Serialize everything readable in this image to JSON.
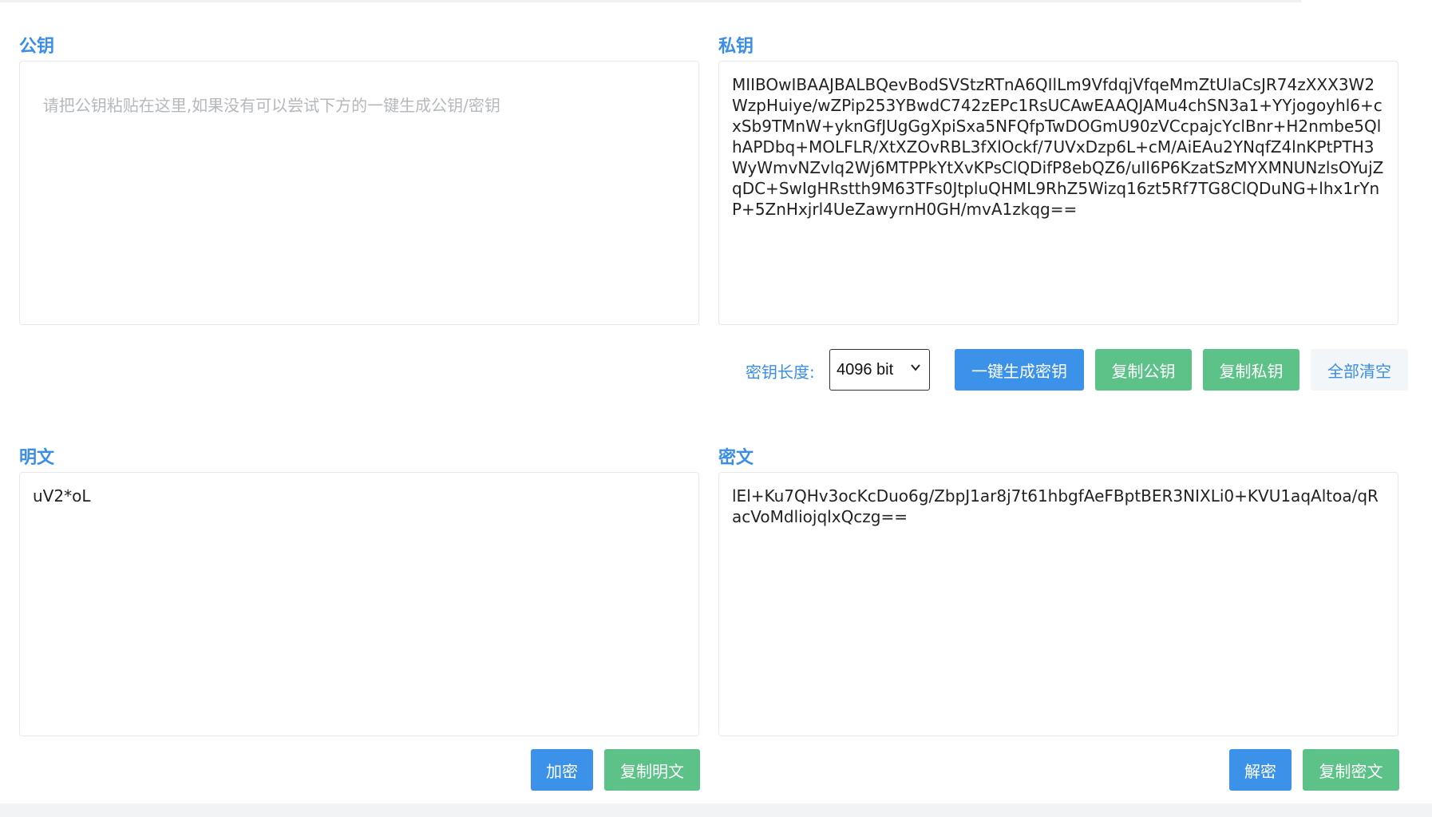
{
  "public_key": {
    "label": "公钥",
    "placeholder": "请把公钥粘贴在这里,如果没有可以尝试下方的一键生成公钥/密钥",
    "value": ""
  },
  "private_key": {
    "label": "私钥",
    "value": "MIIBOwIBAAJBALBQevBodSVStzRTnA6QIlLm9VfdqjVfqeMmZtUlaCsJR74zXXX3W2WzpHuiye/wZPip253YBwdC742zEPc1RsUCAwEAAQJAMu4chSN3a1+YYjogoyhl6+cxSb9TMnW+yknGfJUgGgXpiSxa5NFQfpTwDOGmU90zVCcpajcYclBnr+H2nmbe5QlhAPDbq+MOLFLR/XtXZOvRBL3fXlOckf/7UVxDzp6L+cM/AiEAu2YNqfZ4lnKPtPTH3WyWmvNZvlq2Wj6MTPPkYtXvKPsClQDifP8ebQZ6/uIl6P6KzatSzMYXMNUNzlsOYujZqDC+SwIgHRstth9M63TFs0JtpluQHML9RhZ5Wizq16zt5Rf7TG8ClQDuNG+lhx1rYnP+5ZnHxjrl4UeZawyrnH0GH/mvA1zkqg=="
  },
  "controls": {
    "key_length_label": "密钥长度:",
    "key_length_value": "4096 bit",
    "generate_label": "一键生成密钥",
    "copy_public_label": "复制公钥",
    "copy_private_label": "复制私钥",
    "clear_all_label": "全部清空"
  },
  "plaintext": {
    "label": "明文",
    "value": "uV2*oL",
    "encrypt_label": "加密",
    "copy_label": "复制明文"
  },
  "ciphertext": {
    "label": "密文",
    "value": "lEl+Ku7QHv3ocKcDuo6g/ZbpJ1ar8j7t61hbgfAeFBptBER3NIXLi0+KVU1aqAltoa/qRacVoMdliojqlxQczg==",
    "decrypt_label": "解密",
    "copy_label": "复制密文"
  },
  "colors": {
    "accent_blue": "#3c92e8",
    "accent_green": "#5cc288",
    "label_blue": "#3a8ee6"
  },
  "icons": {
    "select_arrow": "chevron-down-icon"
  }
}
